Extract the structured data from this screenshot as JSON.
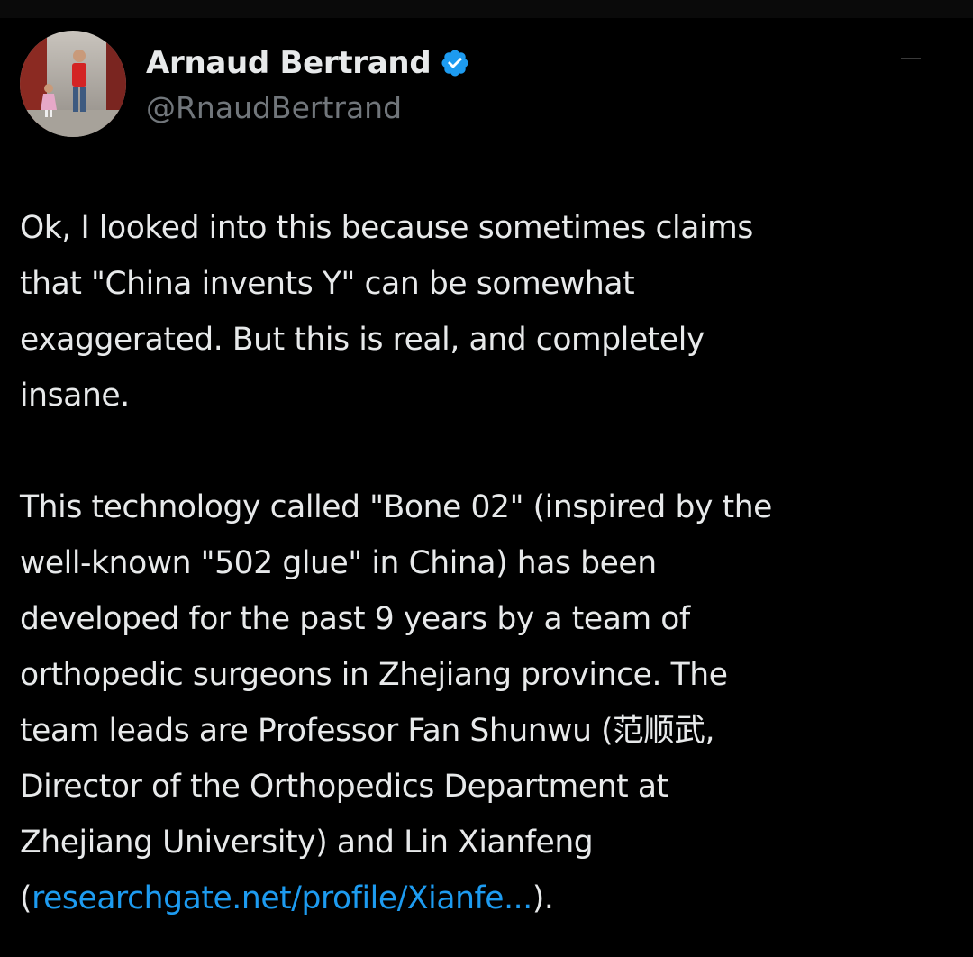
{
  "tweet": {
    "author": {
      "display_name": "Arnaud Bertrand",
      "handle": "@RnaudBertrand",
      "verified": true,
      "verified_color": "#1d9bf0",
      "avatar_icon": "profile-photo"
    },
    "paragraphs": [
      {
        "lines": [
          "Ok, I looked into this because sometimes claims",
          "that \"China invents Y\" can be somewhat",
          "exaggerated. But this is real, and completely",
          "insane."
        ]
      },
      {
        "lines": [
          "This technology called \"Bone 02\" (inspired by the",
          "well-known \"502 glue\" in China) has been",
          "developed for the past 9 years by a team of",
          "orthopedic surgeons in Zhejiang province. The",
          "team leads are Professor Fan Shunwu (范顺武,",
          "Director of the Orthopedics Department at",
          "Zhejiang University) and Lin Xianfeng"
        ],
        "last_line": {
          "prefix": "(",
          "link_text": "researchgate.net/profile/Xianfe...",
          "suffix": ")."
        }
      }
    ],
    "colors": {
      "background": "#000000",
      "text": "#e7e9ea",
      "secondary_text": "#71767b",
      "link": "#1d9bf0"
    }
  }
}
